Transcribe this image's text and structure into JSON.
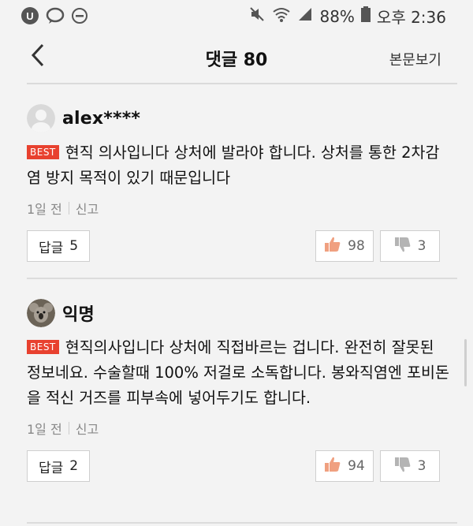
{
  "status_bar": {
    "battery": "88%",
    "time": "오후 2:36",
    "icons": [
      "u-plus-icon",
      "chat-bubble-icon",
      "do-not-disturb-icon",
      "mute-icon",
      "wifi-icon",
      "signal-icon",
      "battery-icon"
    ]
  },
  "header": {
    "back_icon": "chevron-left-icon",
    "title": "댓글 80",
    "view_post": "본문보기"
  },
  "comments": [
    {
      "username": "alex****",
      "badge": "BEST",
      "text": "현직 의사입니다 상처에 발라야 합니다. 상처를 통한 2차감염 방지 목적이 있기 때문입니다",
      "time": "1일 전",
      "report": "신고",
      "reply_label": "답글",
      "reply_count": "5",
      "likes": "98",
      "dislikes": "3",
      "avatar_icon": "default-avatar-icon"
    },
    {
      "username": "익명",
      "badge": "BEST",
      "text": "현직의사입니다 상처에 직접바르는 겁니다. 완전히 잘못된 정보네요. 수술할때 100% 저걸로 소독합니다. 봉와직염엔 포비돈을 적신 거즈를 피부속에 넣어두기도 합니다.",
      "time": "1일 전",
      "report": "신고",
      "reply_label": "답글",
      "reply_count": "2",
      "likes": "94",
      "dislikes": "3",
      "avatar_icon": "koala-avatar-icon"
    }
  ],
  "colors": {
    "background": "#f3f3f3",
    "best_badge": "#e8412f",
    "like_icon": "#f0a080",
    "dislike_icon": "#b4b4b4"
  }
}
